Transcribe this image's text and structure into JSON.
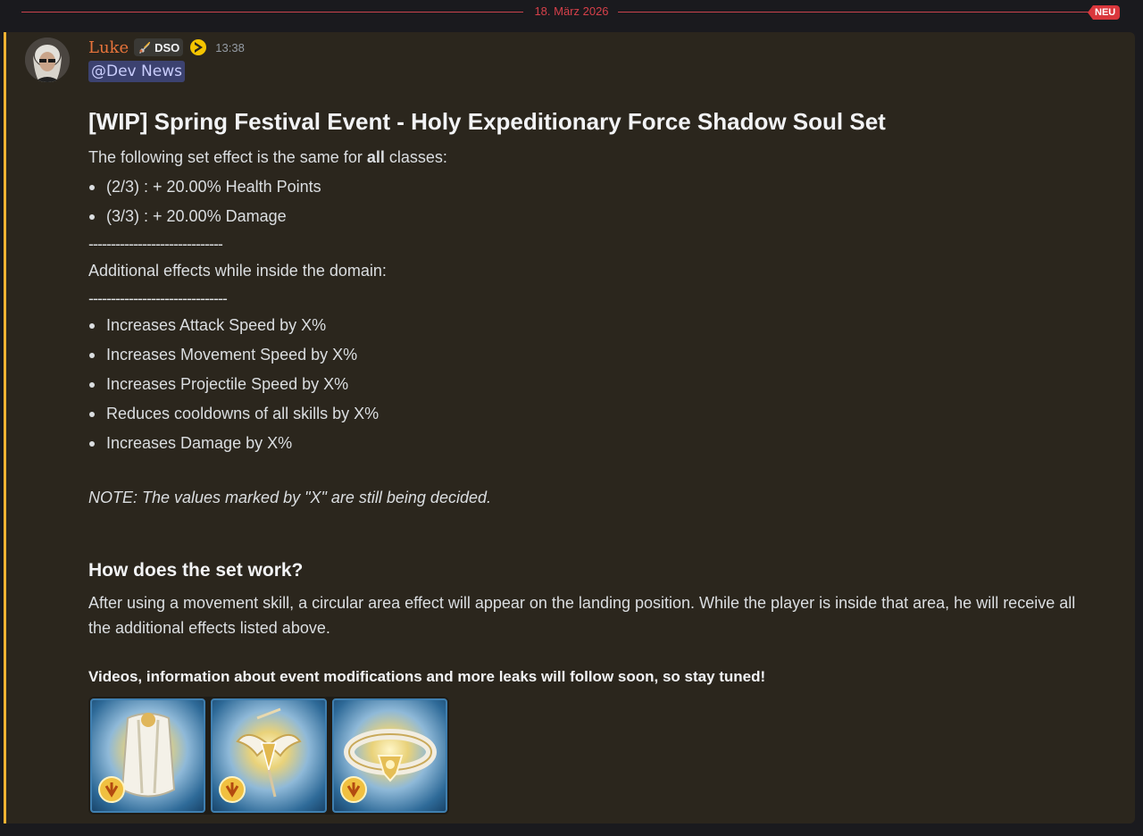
{
  "divider": {
    "date": "18. März 2026",
    "new_label": "NEU"
  },
  "message": {
    "author": "Luke",
    "tag": "DSO",
    "timestamp": "13:38",
    "mention": "@Dev News",
    "title": "[WIP] Spring Festival Event - Holy Expeditionary Force Shadow Soul Set",
    "intro_before": "The following set effect is the same for ",
    "intro_bold": "all",
    "intro_after": " classes:",
    "set_bonuses": [
      "(2/3) :  + 20.00% Health Points",
      "(3/3) :  + 20.00% Damage"
    ],
    "dashes_1": "------------------------------",
    "domain_heading": "Additional effects while inside the domain:",
    "dashes_2": "-------------------------------",
    "domain_effects": [
      "Increases Attack Speed by X%",
      "Increases Movement Speed by X%",
      "Increases Projectile Speed by X%",
      "Reduces cooldowns of all skills by X%",
      "Increases Damage by X%"
    ],
    "note": "NOTE: The values marked by \"X\" are still being decided.",
    "how_heading": "How does the set work?",
    "how_text": "After using a movement skill, a circular area effect will appear on the landing position. While the player is inside that area, he will receive all the additional effects listed above.",
    "closing": "Videos, information about event modifications and more leaks will follow soon, so stay tuned!",
    "attachments": [
      {
        "name": "cape-item-icon"
      },
      {
        "name": "winged-amulet-item-icon"
      },
      {
        "name": "belt-item-icon"
      }
    ]
  },
  "colors": {
    "accent_bar": "#f0b232",
    "new_badge": "#da373c",
    "username": "#e8743b",
    "mention_bg": "#3c4270"
  }
}
